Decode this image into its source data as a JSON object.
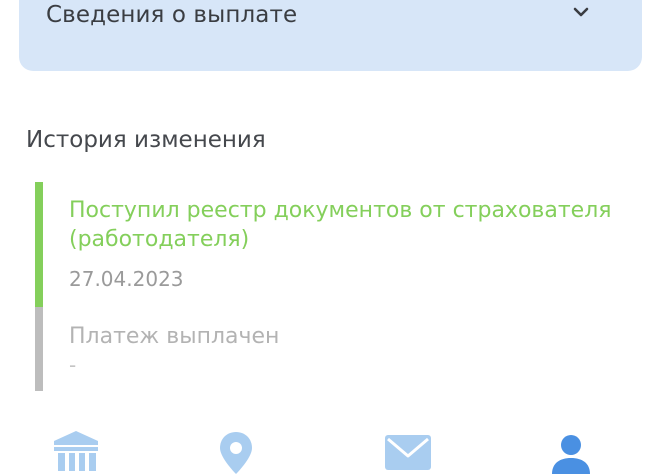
{
  "payout": {
    "title": "Сведения о выплате",
    "expand_icon": "chevron-down-icon"
  },
  "history": {
    "heading": "История изменения",
    "events": [
      {
        "title": "Поступил реестр документов от страхователя (работодателя)",
        "date": "27.04.2023",
        "status_color": "#84cf5b"
      },
      {
        "title": "Платеж выплачен",
        "date": "-",
        "status_color": "#bdbdbd"
      }
    ]
  },
  "tabbar": {
    "tabs": [
      {
        "icon": "bank-icon",
        "color": "#a9cdf0"
      },
      {
        "icon": "location-pin-icon",
        "color": "#a9cdf0"
      },
      {
        "icon": "mail-icon",
        "color": "#a9cdf0"
      },
      {
        "icon": "profile-icon",
        "color": "#4a90e2"
      }
    ]
  },
  "colors": {
    "card_background": "#d7e6f8",
    "accent_green": "#84cf5b",
    "active_tab": "#4a90e2",
    "inactive_tab": "#a9cdf0"
  }
}
